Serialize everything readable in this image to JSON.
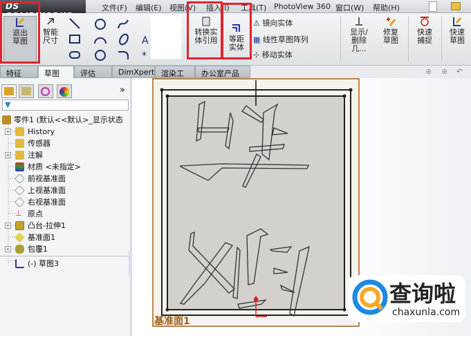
{
  "app": {
    "logo": "DS SOLIDWORKS"
  },
  "menu": [
    "文件(F)",
    "编辑(E)",
    "视图(V)",
    "插入(I)",
    "工具(T)",
    "PhotoView 360",
    "窗口(W)",
    "帮助(H)"
  ],
  "ribbon": {
    "exit_sketch": "退出草图",
    "smart_dim": "智能尺寸",
    "convert": "转换实体引用",
    "offset": "等距实体",
    "mirror": "镜向实体",
    "linear_pattern": "线性草图阵列",
    "move": "移动实体",
    "show_delete": "显示/删除几...",
    "repair": "修复草图",
    "quick_snap": "快速捕捉",
    "rapid_sketch": "快速草图"
  },
  "tabs": [
    "特征",
    "草图",
    "评估",
    "DimXpert",
    "渲染工具",
    "办公室产品"
  ],
  "active_tab": "草图",
  "tree": {
    "root": "零件1 (默认<<默认>_显示状态",
    "items": [
      "History",
      "传感器",
      "注解",
      "材质 <未指定>",
      "前视基准面",
      "上视基准面",
      "右视基准面",
      "原点",
      "凸台-拉伸1",
      "基准面1",
      "包覆1",
      "(-) 草图3"
    ]
  },
  "viewport": {
    "plane_label": "基准面1"
  },
  "watermark": {
    "brand": "查询啦",
    "url": "chaxunla.com"
  },
  "colors": {
    "highlight": "#e0242b",
    "plane": "#a0601c"
  }
}
